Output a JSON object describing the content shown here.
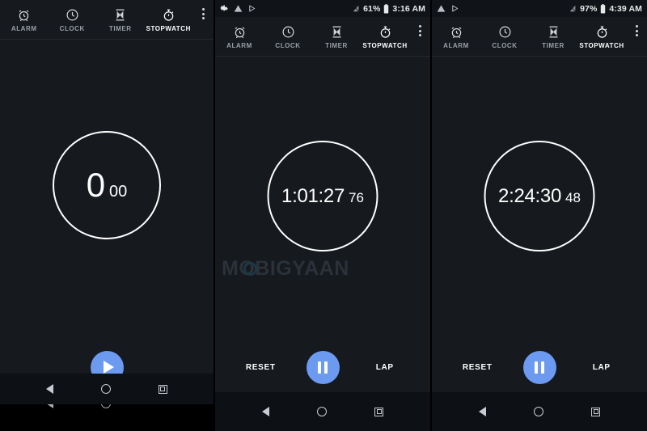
{
  "app": {
    "name": "Clock",
    "accent_color": "#6b9af0",
    "background_color": "#16191e",
    "statusbar_color": "#101318",
    "navbar_color": "#0d1014",
    "text_color": "#ffffff",
    "inactive_tab_color": "#9aa0a8"
  },
  "tabs": [
    {
      "label": "ALARM",
      "icon": "alarm-clock-icon",
      "active": false
    },
    {
      "label": "CLOCK",
      "icon": "clock-icon",
      "active": false
    },
    {
      "label": "TIMER",
      "icon": "hourglass-icon",
      "active": false
    },
    {
      "label": "STOPWATCH",
      "icon": "stopwatch-icon",
      "active": true
    }
  ],
  "overflow": {
    "name": "more-options",
    "icon": "three-dots-vertical-icon"
  },
  "navbar": {
    "back": "back-icon",
    "home": "home-icon",
    "recents": "recents-icon"
  },
  "watermark": {
    "text": "MOBIGYAAN",
    "color": "#5c6a78"
  },
  "panels": [
    {
      "id": "panel-stopped",
      "statusbar": null,
      "time": {
        "main": "0",
        "frac": "00"
      },
      "controls": {
        "primary": {
          "label": "Start",
          "icon": "play-icon"
        },
        "left": null,
        "right": null
      }
    },
    {
      "id": "panel-running-1",
      "statusbar": {
        "left_icons": [
          "gear-icon",
          "warning-triangle-icon",
          "play-triangle-icon"
        ],
        "signal_icon": "no-signal-icon",
        "battery_level": "61%",
        "battery_icon": "battery-icon",
        "time": "3:16 AM"
      },
      "time": {
        "main": "1:01:27",
        "frac": "76"
      },
      "controls": {
        "primary": {
          "label": "Pause",
          "icon": "pause-icon"
        },
        "left": "RESET",
        "right": "LAP"
      }
    },
    {
      "id": "panel-running-2",
      "statusbar": {
        "left_icons": [
          "warning-triangle-icon",
          "play-triangle-icon"
        ],
        "signal_icon": "no-signal-icon",
        "battery_level": "97%",
        "battery_icon": "battery-icon",
        "time": "4:39 AM"
      },
      "time": {
        "main": "2:24:30",
        "frac": "48"
      },
      "controls": {
        "primary": {
          "label": "Pause",
          "icon": "pause-icon"
        },
        "left": "RESET",
        "right": "LAP"
      }
    }
  ]
}
